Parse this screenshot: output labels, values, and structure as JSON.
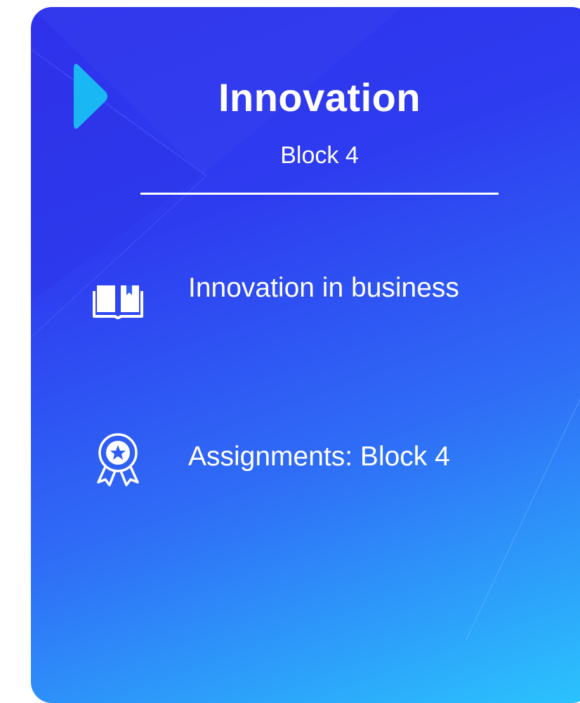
{
  "card": {
    "title": "Innovation",
    "subtitle": "Block 4",
    "accent_color": "#19b7f4",
    "gradient_colors": [
      "#2f31ea",
      "#2f6cf6",
      "#2bc4fd"
    ]
  },
  "menu": {
    "items": [
      {
        "label": "Innovation in business",
        "icon": "open-book-icon"
      },
      {
        "label": "Assignments: Block 4",
        "icon": "award-ribbon-icon"
      }
    ]
  }
}
